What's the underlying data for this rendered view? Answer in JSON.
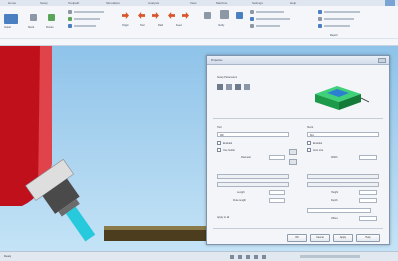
{
  "ribbon": {
    "menu": [
      "Home",
      "Setup",
      "Toolpath",
      "Simulation",
      "Analysis",
      "View",
      "Machine",
      "Settings",
      "Help"
    ],
    "buttons": [
      "Import",
      "Stock",
      "Fixture",
      "Origin",
      "Tool",
      "Path",
      "Feed",
      "Verify",
      "Report"
    ]
  },
  "dialog": {
    "title": "Properties",
    "section_title": "Setup Parameters",
    "left_panel": {
      "header": "Tool",
      "select_value": "Mill",
      "options": [
        "Enabled",
        "Use holder"
      ],
      "fields": [
        "Diameter",
        "Length",
        "Flute length",
        "Corner radius"
      ]
    },
    "right_panel": {
      "header": "Stock",
      "select_value": "Box",
      "options": [
        "Enabled",
        "Auto size"
      ],
      "fields": [
        "Width",
        "Height",
        "Depth",
        "Offset"
      ]
    },
    "footer_note": "Apply to all",
    "buttons": {
      "ok": "OK",
      "cancel": "Cancel",
      "apply": "Apply",
      "help": "Help"
    }
  },
  "status": {
    "text": "Ready"
  },
  "colors": {
    "accent": "#d8572a",
    "sky_top": "#8fc3e9",
    "spindle": "#c0101c",
    "tool": "#27c9dc",
    "model": "#1c9a4a"
  }
}
